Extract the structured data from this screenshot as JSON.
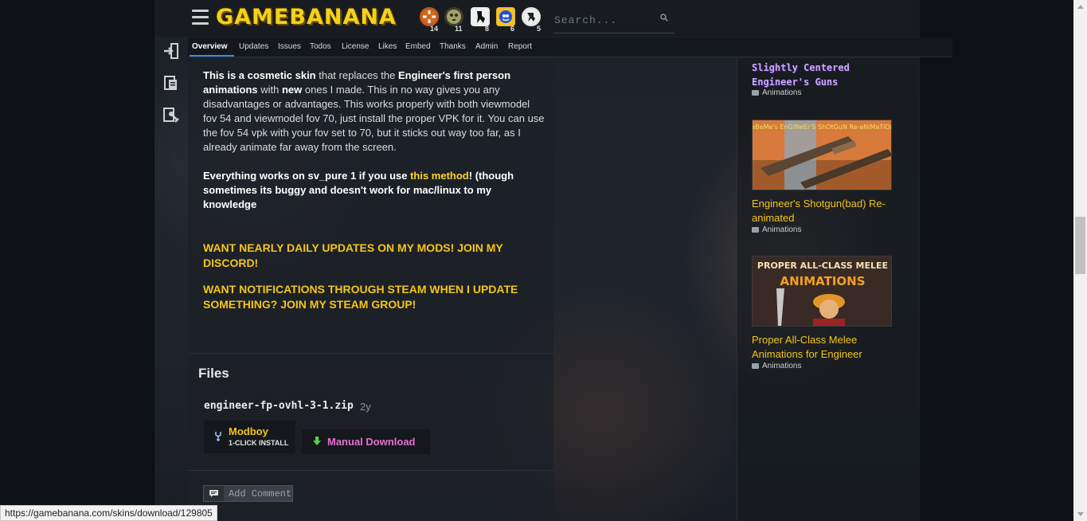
{
  "header": {
    "logo_text": "GAMEBANANA",
    "game_counts": [
      "14",
      "11",
      "8",
      "6",
      "5"
    ],
    "game_icons": [
      "tf2-icon",
      "hl-icon",
      "cs-icon",
      "sonic-icon",
      "csgo-icon"
    ],
    "search_placeholder": "Search..."
  },
  "tabs": {
    "overview": "Overview",
    "updates": "Updates",
    "issues": "Issues",
    "todos": "Todos",
    "license": "License",
    "likes": "Likes",
    "embed": "Embed",
    "thanks": "Thanks",
    "admin": "Admin",
    "report": "Report"
  },
  "description": {
    "p1_a": "This is a cosmetic skin",
    "p1_b": " that replaces the ",
    "p1_c": "Engineer's first person animations",
    "p1_d": " with ",
    "p1_e": "new",
    "p1_f": " ones I made. This in no way gives you any disadvantages or advantages. This works properly with both viewmodel fov 54 and viewmodel fov 70, just install the proper VPK for it. You can use the fov 54 vpk with your fov set to 70, but it sticks out way too far, as I already animate far away from the screen.",
    "p2_a": "Everything works on sv_pure 1 if you use ",
    "p2_link": "this method",
    "p2_b": "! (though sometimes its buggy and doesn't work for mac/linux to my knowledge",
    "callout1": "WANT NEARLY DAILY UPDATES ON MY MODS! JOIN MY DISCORD!",
    "callout2": "WANT NOTIFICATIONS THROUGH STEAM WHEN I UPDATE SOMETHING? JOIN MY STEAM GROUP!"
  },
  "files": {
    "title": "Files",
    "filename": "engineer-fp-ovhl-3-1.zip",
    "age": "2y",
    "modboy_label": "Modboy",
    "modboy_sub": "1-CLICK INSTALL",
    "manual_label": "Manual Download"
  },
  "comments": {
    "add_label": "Add Comment"
  },
  "sidebar": {
    "items": [
      {
        "title": "Slightly Centered Engineer's Guns",
        "category": "Animations"
      },
      {
        "title": "Engineer's Shotgun(bad) Re-animated",
        "category": "Animations",
        "thumb_caption": "aBeMe's EnGINeEr'S ShOtGuN Re-aNiMaTiOn"
      },
      {
        "title": "Proper All-Class Melee Animations for Engineer",
        "category": "Animations",
        "thumb_caption_1": "PROPER ALL-CLASS MELEE",
        "thumb_caption_2": "ANIMATIONS"
      }
    ]
  },
  "status_bar": {
    "url": "https://gamebanana.com/skins/download/129805"
  },
  "colors": {
    "accent_yellow": "#f5c518",
    "manual_pink": "#e86fd3",
    "tab_underline": "#3a8dde",
    "sidebar_title_purple": "#c9a7ff"
  }
}
